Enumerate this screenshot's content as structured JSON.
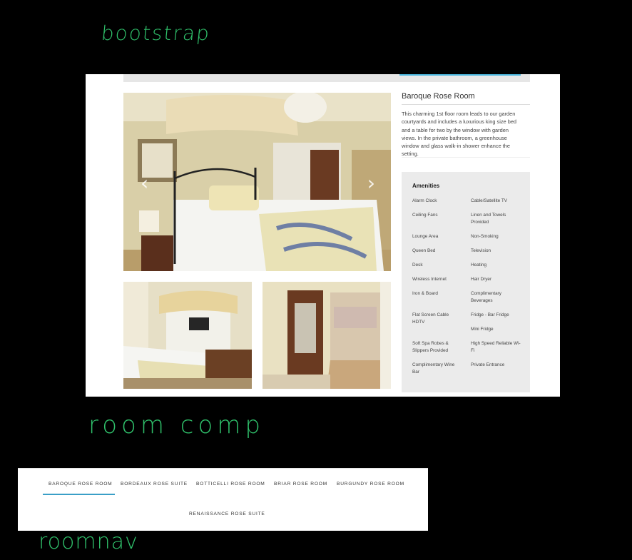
{
  "annotations": {
    "bootstrap": "bootstrap",
    "room_comp": "room comp",
    "room_nav": "roomnav"
  },
  "room": {
    "title": "Baroque Rose Room",
    "description": "This charming 1st floor room leads to our garden courtyards and includes a luxurious king size bed and a table for two by the window with garden views. In the private bathroom, a greenhouse window and glass walk-in shower enhance the setting.",
    "carousel": {
      "prev_glyph": "‹",
      "next_glyph": "›"
    },
    "amenities_title": "Amenities",
    "amenities": [
      "Alarm Clock",
      "Cable/Satellite TV",
      "Ceiling Fans",
      "Linen and Towels Provided",
      "Lounge Area",
      "Non-Smoking",
      "Queen Bed",
      "Television",
      "Desk",
      "Heating",
      "Wireless Internet",
      "Hair Dryer",
      "Iron & Board",
      "Complimentary Beverages",
      "Flat Screen Cable HDTV",
      "Fridge - Bar Fridge",
      "",
      "Mini Fridge",
      "Soft Spa Robes & Slippers Provided",
      "High Speed Reliable Wi-Fi",
      "Complimentary Wine Bar",
      "Private Entrance"
    ]
  },
  "room_nav": {
    "tabs": [
      "BAROQUE ROSE ROOM",
      "BORDEAUX ROSE SUITE",
      "BOTTICELLI ROSE ROOM",
      "BRIAR ROSE ROOM",
      "BURGUNDY ROSE ROOM",
      "RENAISSANCE ROSE SUITE"
    ],
    "active_index": 0
  },
  "colors": {
    "annotation_green": "#2fbf6a",
    "accent_blue": "#3a9fc7",
    "amenities_bg": "#ebebeb"
  }
}
